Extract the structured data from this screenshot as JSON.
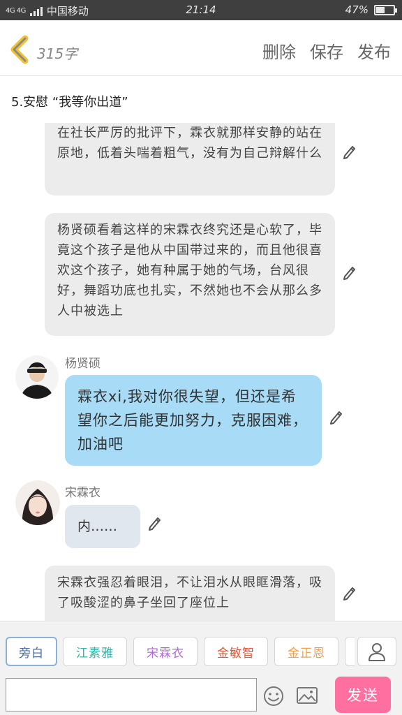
{
  "status_bar": {
    "signal": "4G 4G",
    "carrier": "中国移动",
    "time": "21:14",
    "battery": "47%"
  },
  "header": {
    "word_count": "315字",
    "actions": {
      "delete": "删除",
      "save": "保存",
      "publish": "发布"
    }
  },
  "chapter_title": "5.安慰 “我等你出道”",
  "messages": {
    "narration_1": "在社长严厉的批评下，霖衣就那样安静的站在原地，低着头喘着粗气，没有为自己辩解什么",
    "narration_2": "杨贤硕看着这样的宋霖衣终究还是心软了，毕竟这个孩子是他从中国带过来的，而且他很喜欢这个孩子，她有种属于她的气场，台风很好，舞蹈功底也扎实，不然她也不会从那么多人中被选上",
    "speaker_1": {
      "name": "杨贤硕",
      "text": "霖衣xi,我对你很失望，但还是希望你之后能更加努力，克服困难，加油吧"
    },
    "speaker_2": {
      "name": "宋霖衣",
      "text": "内……"
    },
    "narration_3": "宋霖衣强忍着眼泪，不让泪水从眼眶滑落，吸了吸酸涩的鼻子坐回了座位上"
  },
  "roles": [
    {
      "label": "旁白",
      "color": "#4a6fa5"
    },
    {
      "label": "江素雅",
      "color": "#2fb3a8"
    },
    {
      "label": "宋霖衣",
      "color": "#b36ad9"
    },
    {
      "label": "金敏智",
      "color": "#e0563a"
    },
    {
      "label": "金正恩",
      "color": "#f0a04a"
    }
  ],
  "input": {
    "placeholder": "",
    "send_label": "发送"
  },
  "colors": {
    "accent_back": "#f2c230",
    "blue_bubble": "#a7dbf6",
    "send_button": "#ff6f9f"
  },
  "icons": [
    "back-chevron-icon",
    "pencil-icon",
    "add-person-icon",
    "emoji-icon",
    "image-icon"
  ]
}
